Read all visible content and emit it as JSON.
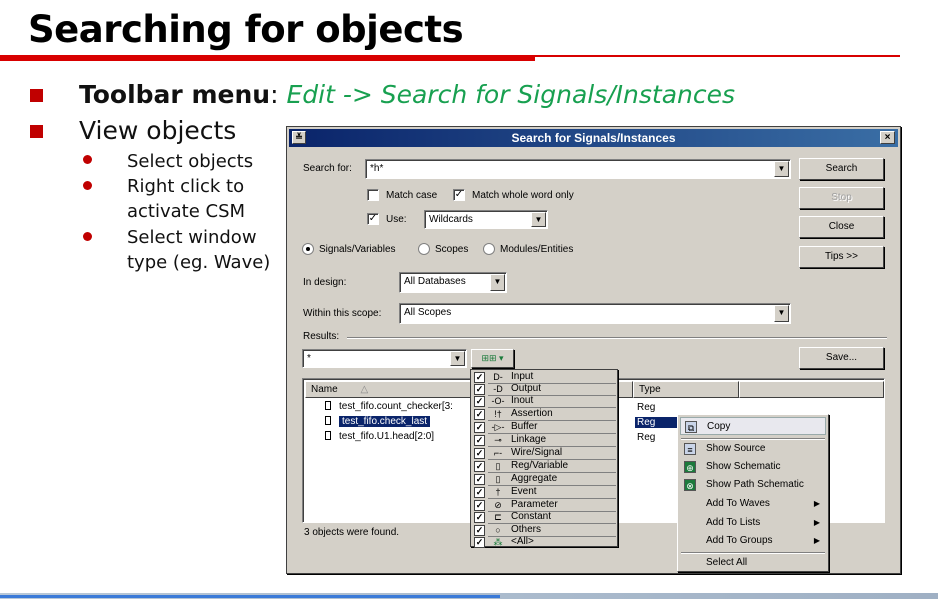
{
  "slide": {
    "title": "Searching for objects",
    "bullet1_bold": "Toolbar menu",
    "bullet1_colon": ":",
    "bullet1_path": "Edit -> Search for Signals/Instances",
    "bullet2": "View objects",
    "sub1": "Select objects",
    "sub2_line1": "Right click to",
    "sub2_line2": "activate CSM",
    "sub3_line1": "Select window",
    "sub3_line2": "type (eg. Wave)"
  },
  "dialog": {
    "title": "Search for Signals/Instances",
    "sys_menu_glyph": "≚",
    "close_glyph": "×",
    "search_for_label": "Search for:",
    "search_value": "*h*",
    "match_case_label": "Match case",
    "match_case_checked": false,
    "match_whole_word_label": "Match whole word only",
    "match_whole_word_checked": true,
    "use_label": "Use:",
    "use_checked": true,
    "use_value": "Wildcards",
    "scope_options": [
      "Signals/Variables",
      "Scopes",
      "Modules/Entities"
    ],
    "scope_selected": "Signals/Variables",
    "in_design_label": "In design:",
    "in_design_value": "All Databases",
    "within_scope_label": "Within this scope:",
    "within_scope_value": "All Scopes",
    "results_label": "Results:",
    "results_filter_value": "*",
    "buttons": {
      "search": "Search",
      "stop": "Stop",
      "close": "Close",
      "tips": "Tips >>",
      "save": "Save..."
    },
    "columns": [
      "Name",
      "Type"
    ],
    "rows": [
      {
        "name": "test_fifo.count_checker[3:",
        "type": "Reg",
        "selected": false
      },
      {
        "name": "test_fifo.check_last",
        "type": "Reg",
        "selected": true
      },
      {
        "name": "test_fifo.U1.head[2:0]",
        "type": "Reg",
        "selected": false
      }
    ],
    "status": "3 objects were found."
  },
  "filter_list": [
    {
      "icon": "D-",
      "label": "Input"
    },
    {
      "icon": "-D",
      "label": "Output"
    },
    {
      "icon": "-O-",
      "label": "Inout"
    },
    {
      "icon": "!†",
      "label": "Assertion"
    },
    {
      "icon": "-▷-",
      "label": "Buffer"
    },
    {
      "icon": "⊸",
      "label": "Linkage"
    },
    {
      "icon": "⌐-",
      "label": "Wire/Signal"
    },
    {
      "icon": "▯",
      "label": "Reg/Variable"
    },
    {
      "icon": "▯",
      "label": "Aggregate"
    },
    {
      "icon": "†",
      "label": "Event"
    },
    {
      "icon": "⊘",
      "label": "Parameter"
    },
    {
      "icon": "⊏",
      "label": "Constant"
    },
    {
      "icon": "○",
      "label": "Others"
    },
    {
      "icon": "⁂",
      "label": "<All>"
    }
  ],
  "context_menu": [
    {
      "icon": "copy",
      "label": "Copy",
      "submenu": false,
      "highlight": true
    },
    {
      "icon": "source",
      "label": "Show Source",
      "submenu": false
    },
    {
      "icon": "schematic",
      "label": "Show Schematic",
      "submenu": false
    },
    {
      "icon": "path-schematic",
      "label": "Show Path Schematic",
      "submenu": false
    },
    {
      "icon": "",
      "label": "Add To Waves",
      "submenu": true
    },
    {
      "icon": "",
      "label": "Add To Lists",
      "submenu": true
    },
    {
      "icon": "",
      "label": "Add To Groups",
      "submenu": true
    },
    {
      "icon": "",
      "label": "Select All",
      "submenu": false
    }
  ],
  "glyphs": {
    "check": "✓",
    "dropdown": "▼",
    "submenu": "▶",
    "sort": "△"
  }
}
